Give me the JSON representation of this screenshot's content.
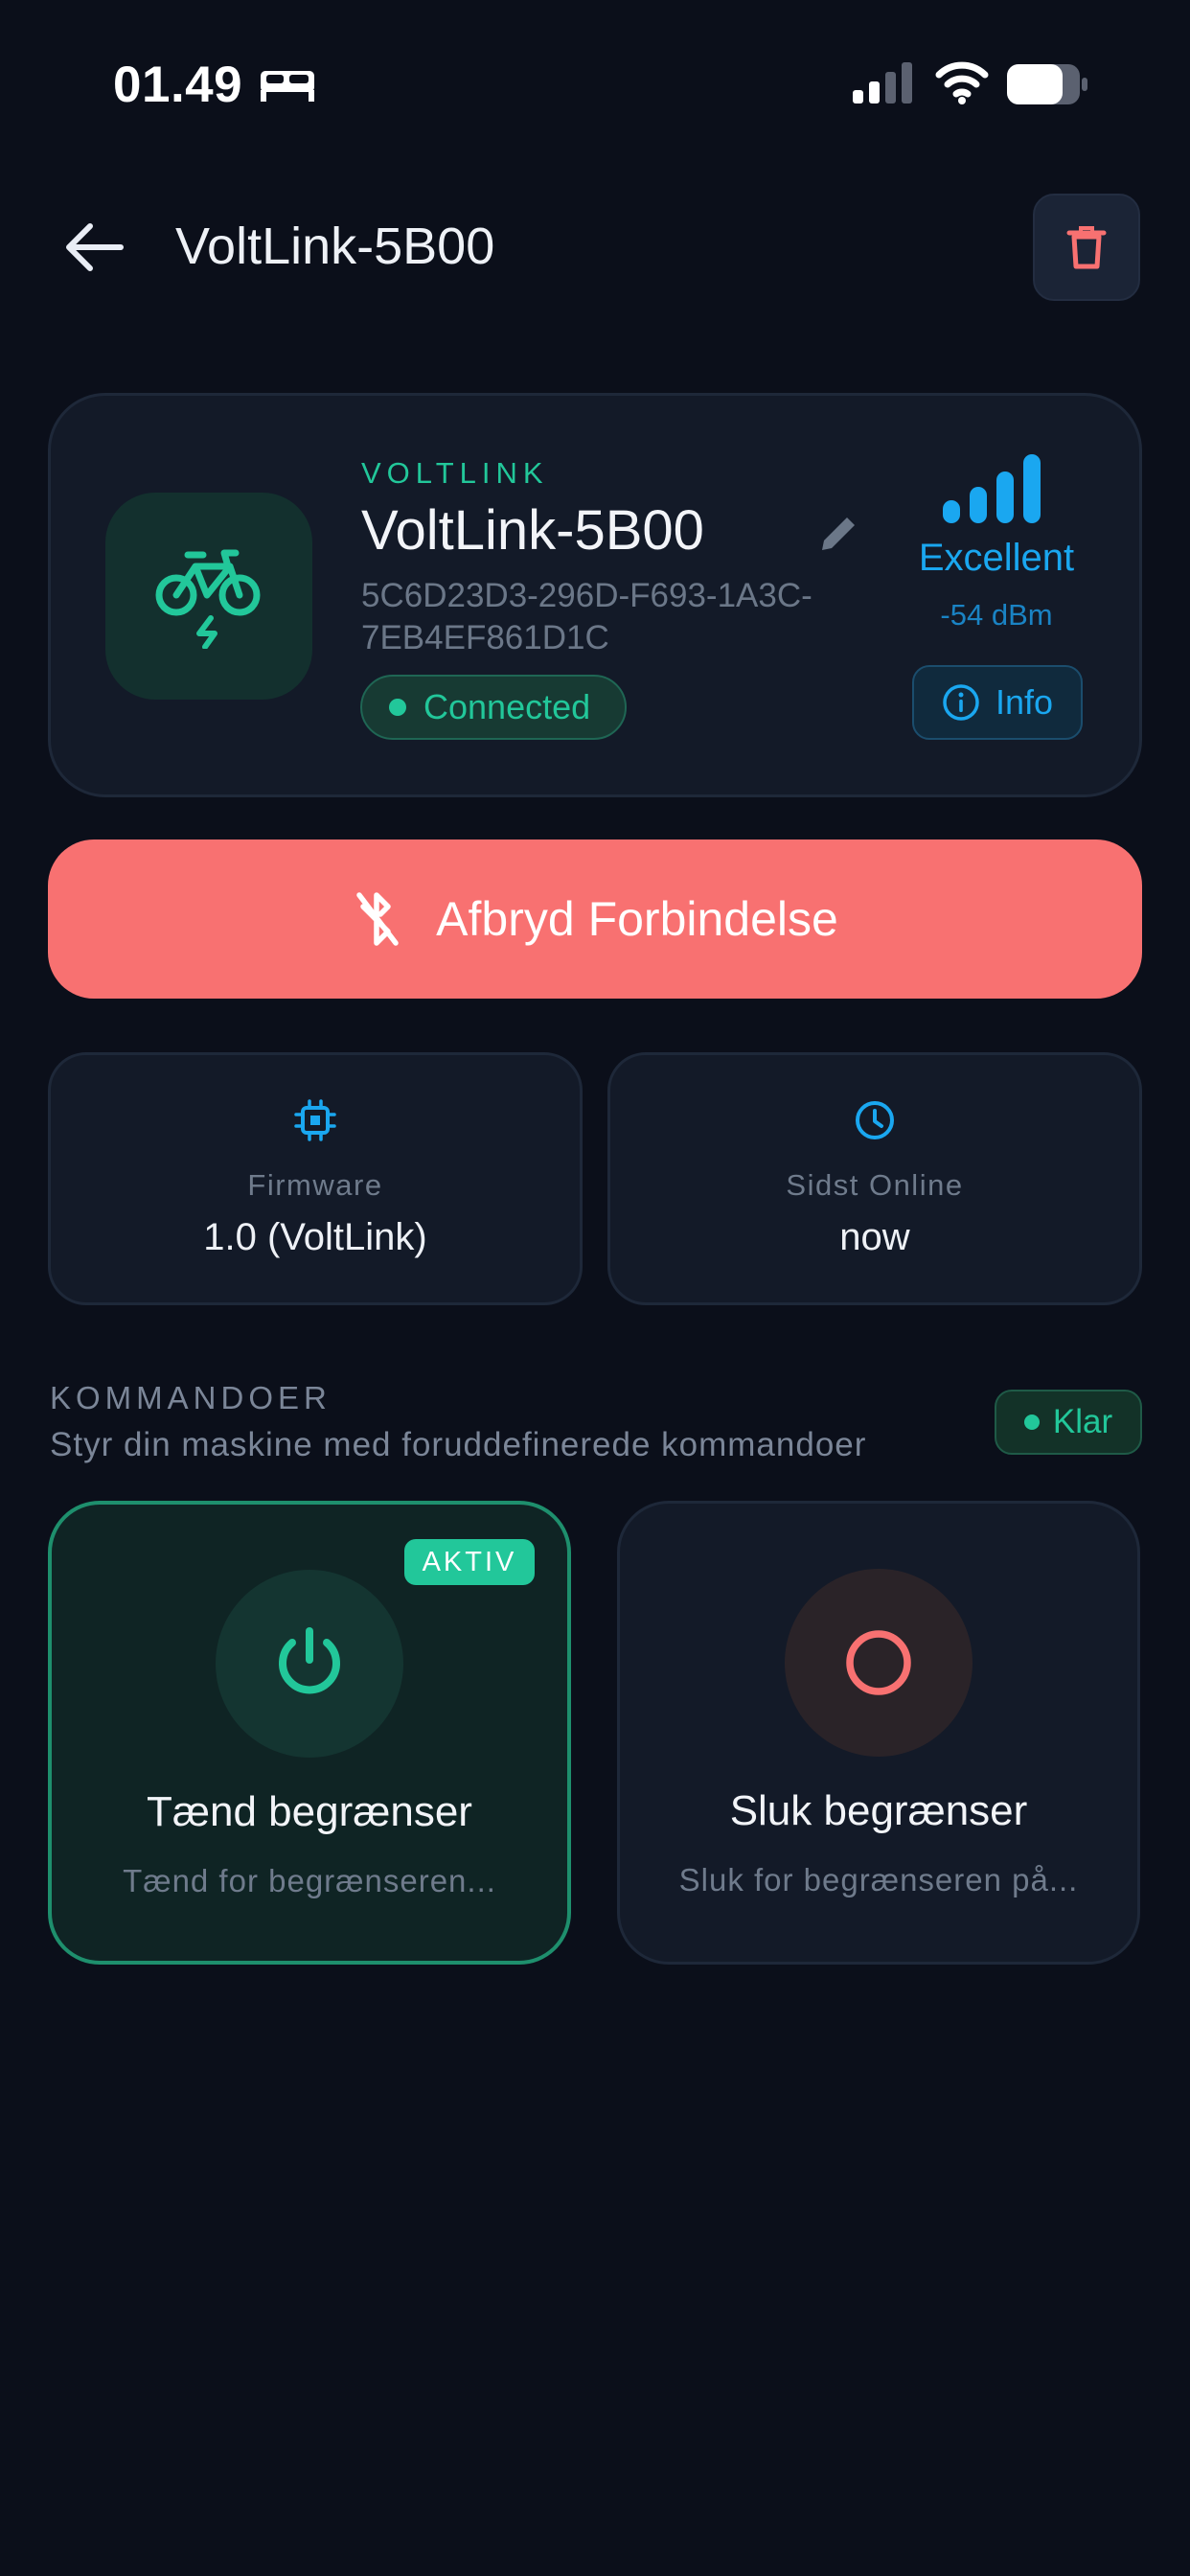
{
  "status_bar": {
    "time": "01.49",
    "icons": [
      "bed-icon",
      "cellular-signal-icon",
      "wifi-icon",
      "battery-icon"
    ]
  },
  "header": {
    "title": "VoltLink-5B00",
    "icons": [
      "back-arrow-icon",
      "trash-icon"
    ]
  },
  "device": {
    "brand": "VOLTLINK",
    "name": "VoltLink-5B00",
    "uuid": "5C6D23D3-296D-F693-1A3C-7EB4EF861D1C",
    "status": "Connected",
    "signal_label": "Excellent",
    "signal_dbm": "-54 dBm",
    "info_label": "Info",
    "icon": "electric-bike-icon"
  },
  "disconnect_button": {
    "label": "Afbryd Forbindelse",
    "icon": "bluetooth-off-icon"
  },
  "stats": {
    "firmware": {
      "label": "Firmware",
      "value": "1.0 (VoltLink)",
      "icon": "chip-icon"
    },
    "last_online": {
      "label": "Sidst Online",
      "value": "now",
      "icon": "clock-icon"
    }
  },
  "commands": {
    "title": "KOMMANDOER",
    "subtitle": "Styr din maskine med foruddefinerede kommandoer",
    "status": "Klar",
    "items": [
      {
        "name": "Tænd begrænser",
        "description": "Tænd for begrænseren...",
        "badge": "AKTIV",
        "icon": "power-icon"
      },
      {
        "name": "Sluk begrænser",
        "description": "Sluk for begrænseren på...",
        "icon": "circle-icon"
      }
    ]
  },
  "colors": {
    "background": "#0b0f1a",
    "card": "#131a28",
    "accent_green": "#22c79a",
    "accent_blue": "#1aa7f0",
    "danger": "#f87171"
  }
}
